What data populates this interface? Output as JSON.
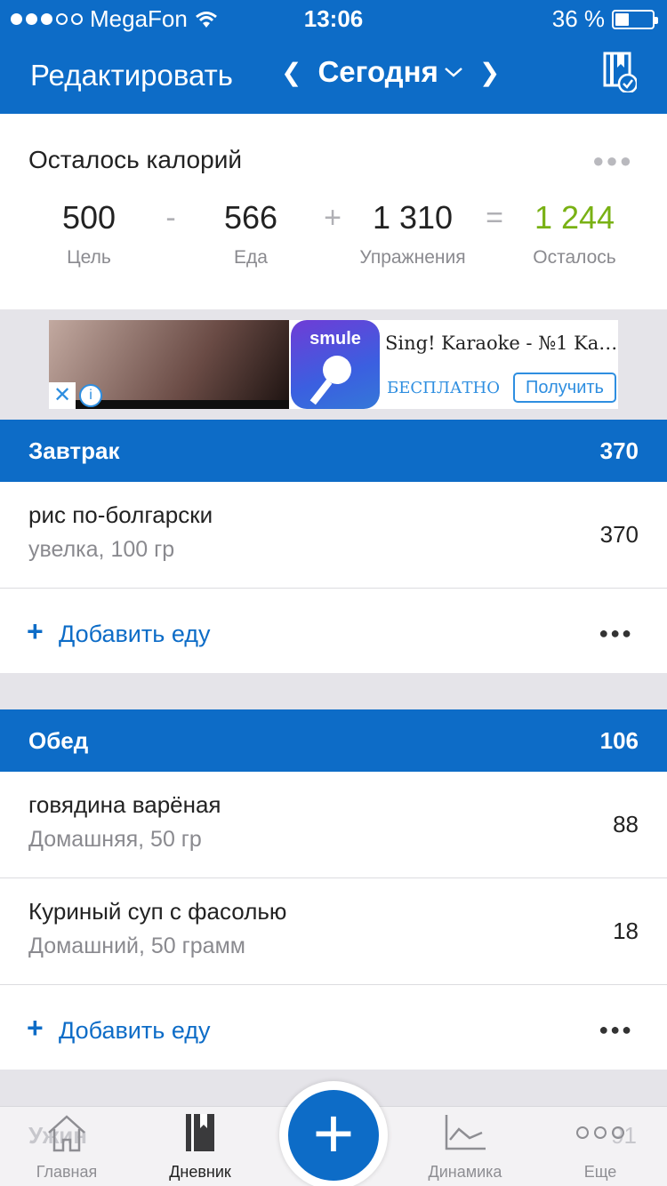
{
  "status_bar": {
    "carrier": "MegaFon",
    "time": "13:06",
    "battery": "36 %"
  },
  "nav": {
    "edit_label": "Редактировать",
    "title": "Сегодня"
  },
  "calories": {
    "title": "Осталось калорий",
    "goal": {
      "value": "500",
      "label": "Цель"
    },
    "food": {
      "value": "566",
      "label": "Еда"
    },
    "exercise": {
      "value": "1 310",
      "label": "Упражнения"
    },
    "remaining": {
      "value": "1 244",
      "label": "Осталось"
    },
    "ops": {
      "minus": "-",
      "plus": "+",
      "equals": "="
    }
  },
  "ad": {
    "app_brand": "smule",
    "title": "Sing! Karaoke - №1 Ka…",
    "price": "БЕСПЛАТНО",
    "cta": "Получить"
  },
  "meals": [
    {
      "name": "Завтрак",
      "calories": "370",
      "items": [
        {
          "name": "рис по-болгарски",
          "desc": "увелка, 100 гр",
          "calories": "370"
        }
      ],
      "add_label": "Добавить еду"
    },
    {
      "name": "Обед",
      "calories": "106",
      "items": [
        {
          "name": "говядина варёная",
          "desc": "Домашняя, 50 гр",
          "calories": "88"
        },
        {
          "name": "Куриный суп с фасолью",
          "desc": "Домашний, 50 грамм",
          "calories": "18"
        }
      ],
      "add_label": "Добавить еду"
    }
  ],
  "hidden_meal": {
    "name_partial": "Ужин",
    "calories_partial": "91"
  },
  "tabbar": {
    "home": "Главная",
    "diary": "Дневник",
    "progress": "Динамика",
    "more": "Еще",
    "active": "diary"
  },
  "colors": {
    "brand_blue": "#0d6cc7",
    "remaining_green": "#79b114",
    "link_blue": "#2e8ee0"
  }
}
